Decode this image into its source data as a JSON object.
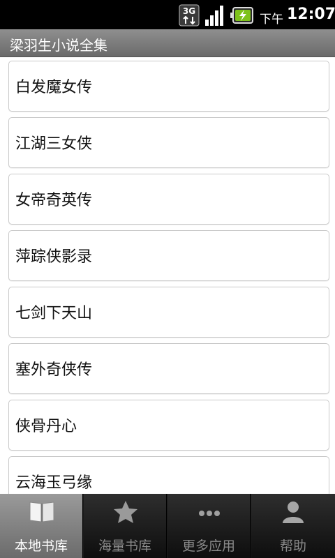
{
  "status_bar": {
    "network": "3G",
    "ampm": "下午",
    "time": "12:07"
  },
  "app": {
    "title": "梁羽生小说全集"
  },
  "books": [
    "白发魔女传",
    "江湖三女侠",
    "女帝奇英传",
    "萍踪侠影录",
    "七剑下天山",
    "塞外奇侠传",
    "侠骨丹心",
    "云海玉弓缘"
  ],
  "tabs": [
    {
      "label": "本地书库",
      "icon": "book-icon",
      "active": true
    },
    {
      "label": "海量书库",
      "icon": "star-icon",
      "active": false
    },
    {
      "label": "更多应用",
      "icon": "more-icon",
      "active": false
    },
    {
      "label": "帮助",
      "icon": "person-icon",
      "active": false
    }
  ]
}
